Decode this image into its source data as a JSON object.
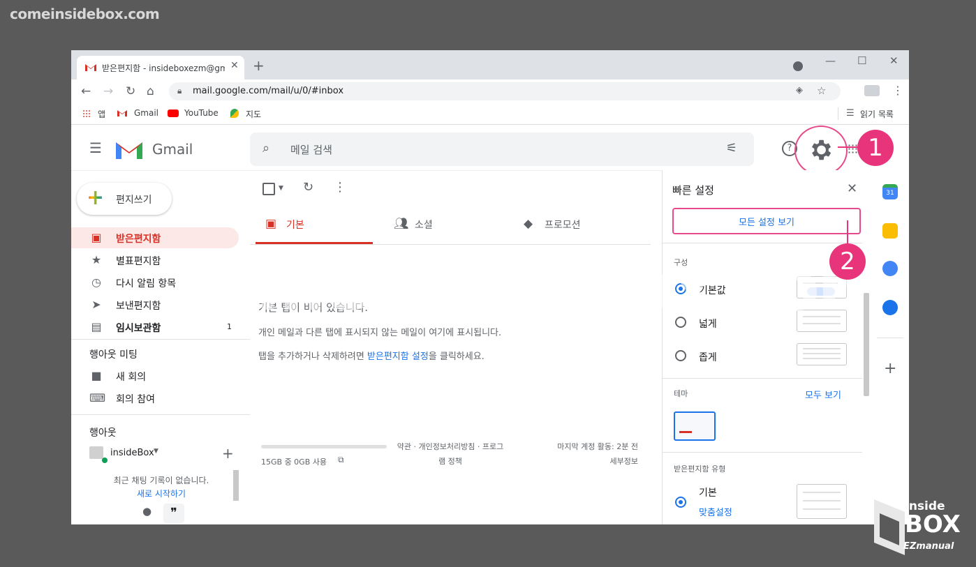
{
  "watermark": {
    "site": "comeinsidebox.com",
    "center": "comeinsidebox.com"
  },
  "browser": {
    "tab_title": "받은편지함 - insideboxezm@gm",
    "url": "mail.google.com/mail/u/0/#inbox",
    "bookmarks": [
      "앱",
      "Gmail",
      "YouTube",
      "지도"
    ],
    "reading_list": "읽기 목록"
  },
  "gmail": {
    "logo_text": "Gmail",
    "search_placeholder": "메일 검색",
    "compose_label": "편지쓰기",
    "nav": [
      {
        "label": "받은편지함",
        "icon": "inbox-icon",
        "active": true
      },
      {
        "label": "별표편지함",
        "icon": "star-icon"
      },
      {
        "label": "다시 알림 항목",
        "icon": "clock-icon"
      },
      {
        "label": "보낸편지함",
        "icon": "send-icon"
      },
      {
        "label": "임시보관함",
        "icon": "draft-icon",
        "count": "1"
      }
    ],
    "meet": {
      "header": "행아웃 미팅",
      "items": [
        "새 회의",
        "회의 참여"
      ]
    },
    "hangouts": {
      "header": "행아웃",
      "user": "insideBox",
      "empty_text": "최근 채팅 기록이 없습니다.",
      "start_link": "새로 시작하기"
    },
    "category_tabs": [
      "기본",
      "소셜",
      "프로모션"
    ],
    "empty": {
      "title": "기본 탭이 비어 있습니다.",
      "line1": "개인 메일과 다른 탭에 표시되지 않는 메일이 여기에 표시됩니다.",
      "line2_prefix": "탭을 추가하거나 삭제하려면 ",
      "line2_link": "받은편지함 설정",
      "line2_suffix": "을 클릭하세요."
    },
    "footer": {
      "storage": "15GB 중 0GB 사용",
      "storage_used_fraction": 0,
      "terms_line1": "약관 · 개인정보처리방침 · 프로그",
      "terms_line2": "램 정책",
      "activity_line1": "마지막 계정 활동: 2분 전",
      "activity_line2": "세부정보"
    },
    "quick_settings": {
      "title": "빠른 설정",
      "all_settings": "모든 설정 보기",
      "density_header": "구성",
      "density": [
        {
          "label": "기본값",
          "selected": true
        },
        {
          "label": "넓게",
          "selected": false
        },
        {
          "label": "좁게",
          "selected": false
        }
      ],
      "theme_header": "테마",
      "theme_link": "모두 보기",
      "inbox_type_header": "받은편지함 유형",
      "inbox_type": "기본",
      "inbox_type_link": "맞춤설정"
    }
  },
  "annotations": {
    "step1": "1",
    "step2": "2"
  },
  "logo": {
    "line1": "inside",
    "line2": "BOX",
    "line3": "EZmanual"
  },
  "colors": {
    "accent": "#e8347a",
    "gmail_red": "#d93025",
    "link": "#1a73e8"
  }
}
